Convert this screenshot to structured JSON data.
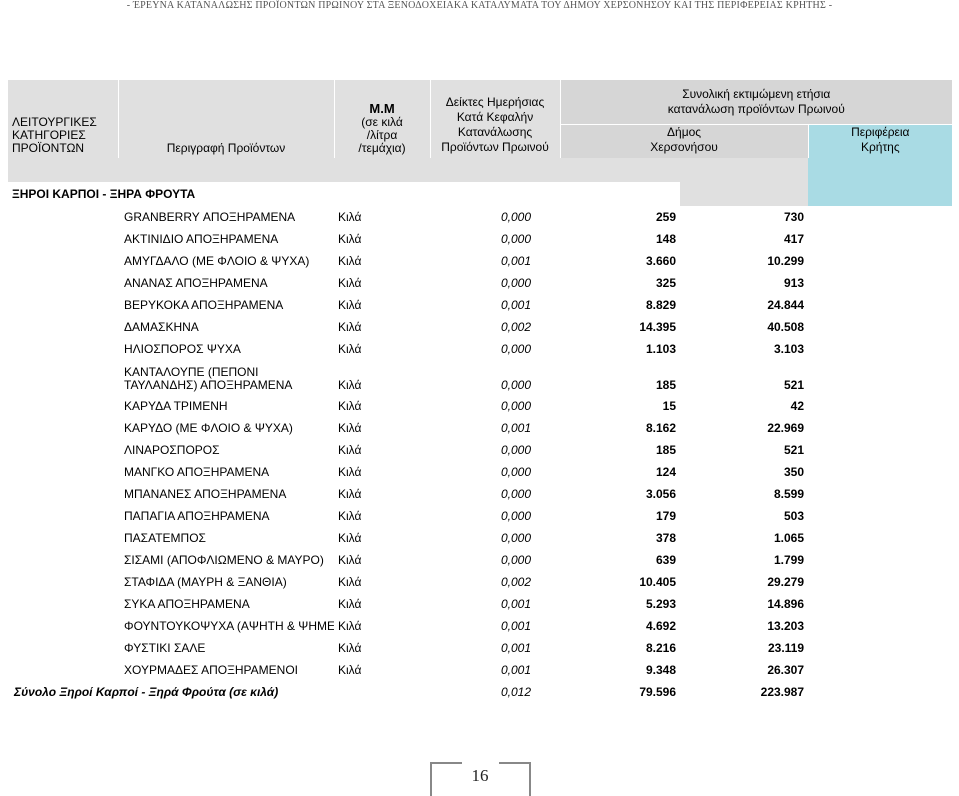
{
  "running_header": "- ΈΡΕΥΝΑ ΚΑΤΑΝΑΛΩΣΗΣ ΠΡΟΪΟΝΤΩΝ ΠΡΩΙΝΟΥ ΣΤΑ ΞΕΝΟΔΟΧΕΙΑΚΑ ΚΑΤΑΛΥΜΑΤΑ ΤΟΥ ΔΗΜΟΥ ΧΕΡΣΟΝΗΣΟΥ ΚΑΙ ΤΗΣ ΠΕΡΙΦΕΡΕΙΑΣ ΚΡΗΤΗΣ -",
  "header": {
    "category": [
      "ΛΕΙΤΟΥΡΓΙΚΕΣ",
      "ΚΑΤΗΓΟΡΙΕΣ",
      "ΠΡΟΪΟΝΤΩΝ"
    ],
    "description": "Περιγραφή Προϊόντων",
    "unit": [
      "Μ.Μ",
      "(σε κιλά",
      "/λίτρα",
      "/τεμάχια)"
    ],
    "index": [
      "Δείκτες Ημερήσιας",
      "Κατά Κεφαλήν",
      "Κατανάλωσης",
      "Προϊόντων Πρωινού"
    ],
    "total": [
      "Συνολική εκτιμώμενη ετήσια",
      "κατανάλωση προϊόντων Πρωινού"
    ],
    "dimos": [
      "Δήμος",
      "Χερσονήσου"
    ],
    "perifereia": [
      "Περιφέρεια",
      "Κρήτης"
    ]
  },
  "section_title": "ΞΗΡΟΙ ΚΑΡΠΟΙ - ΞΗΡΑ ΦΡΟΥΤΑ",
  "rows": [
    {
      "name": "GRANBERRY ΑΠΟΞΗΡΑΜΕΝΑ",
      "unit": "Κιλά",
      "index": "0,000",
      "dimos": "259",
      "perifereia": "730"
    },
    {
      "name": "ΑΚΤΙΝΙΔΙΟ ΑΠΟΞΗΡΑΜΕΝΑ",
      "unit": "Κιλά",
      "index": "0,000",
      "dimos": "148",
      "perifereia": "417"
    },
    {
      "name": "ΑΜΥΓΔΑΛΟ (ΜΕ ΦΛΟΙΟ & ΨΥΧΑ)",
      "unit": "Κιλά",
      "index": "0,001",
      "dimos": "3.660",
      "perifereia": "10.299"
    },
    {
      "name": "ΑΝΑΝΑΣ ΑΠΟΞΗΡΑΜΕΝΑ",
      "unit": "Κιλά",
      "index": "0,000",
      "dimos": "325",
      "perifereia": "913"
    },
    {
      "name": "ΒΕΡΥΚΟΚΑ ΑΠΟΞΗΡΑΜΕΝΑ",
      "unit": "Κιλά",
      "index": "0,001",
      "dimos": "8.829",
      "perifereia": "24.844"
    },
    {
      "name": "ΔΑΜΑΣΚΗΝΑ",
      "unit": "Κιλά",
      "index": "0,002",
      "dimos": "14.395",
      "perifereia": "40.508"
    },
    {
      "name": "ΗΛΙΟΣΠΟΡΟΣ ΨΥΧΑ",
      "unit": "Κιλά",
      "index": "0,000",
      "dimos": "1.103",
      "perifereia": "3.103"
    },
    {
      "name": "ΚΑΝΤΑΛΟΥΠΕ (ΠΕΠΟΝΙ ΤΑΥΛΑΝΔΗΣ) ΑΠΟΞΗΡΑΜΕΝΑ",
      "unit": "Κιλά",
      "index": "0,000",
      "dimos": "185",
      "perifereia": "521"
    },
    {
      "name": "ΚΑΡΥΔΑ ΤΡΙΜΕΝΗ",
      "unit": "Κιλά",
      "index": "0,000",
      "dimos": "15",
      "perifereia": "42"
    },
    {
      "name": "ΚΑΡΥΔΟ (ΜΕ ΦΛΟΙΟ & ΨΥΧΑ)",
      "unit": "Κιλά",
      "index": "0,001",
      "dimos": "8.162",
      "perifereia": "22.969"
    },
    {
      "name": "ΛΙΝΑΡΟΣΠΟΡΟΣ",
      "unit": "Κιλά",
      "index": "0,000",
      "dimos": "185",
      "perifereia": "521"
    },
    {
      "name": "ΜΑΝΓΚΟ ΑΠΟΞΗΡΑΜΕΝΑ",
      "unit": "Κιλά",
      "index": "0,000",
      "dimos": "124",
      "perifereia": "350"
    },
    {
      "name": "ΜΠΑΝΑΝΕΣ ΑΠΟΞΗΡΑΜΕΝΑ",
      "unit": "Κιλά",
      "index": "0,000",
      "dimos": "3.056",
      "perifereia": "8.599"
    },
    {
      "name": "ΠΑΠΑΓΙΑ ΑΠΟΞΗΡΑΜΕΝΑ",
      "unit": "Κιλά",
      "index": "0,000",
      "dimos": "179",
      "perifereia": "503"
    },
    {
      "name": "ΠΑΣΑΤΕΜΠΟΣ",
      "unit": "Κιλά",
      "index": "0,000",
      "dimos": "378",
      "perifereia": "1.065"
    },
    {
      "name": "ΣΙΣΑΜΙ (ΑΠΟΦΛΙΩΜΕΝΟ & ΜΑΥΡΟ)",
      "unit": "Κιλά",
      "index": "0,000",
      "dimos": "639",
      "perifereia": "1.799"
    },
    {
      "name": "ΣΤΑΦΙΔΑ (ΜΑΥΡΗ & ΞΑΝΘΙΑ)",
      "unit": "Κιλά",
      "index": "0,002",
      "dimos": "10.405",
      "perifereia": "29.279"
    },
    {
      "name": "ΣΥΚΑ ΑΠΟΞΗΡΑΜΕΝΑ",
      "unit": "Κιλά",
      "index": "0,001",
      "dimos": "5.293",
      "perifereia": "14.896"
    },
    {
      "name": "ΦΟΥΝΤΟΥΚΟΨΥΧΑ (ΑΨΗΤΗ & ΨΗΜΕΝΑ)",
      "unit": "Κιλά",
      "index": "0,001",
      "dimos": "4.692",
      "perifereia": "13.203"
    },
    {
      "name": "ΦΥΣΤΙΚΙ ΣΑΛΕ",
      "unit": "Κιλά",
      "index": "0,001",
      "dimos": "8.216",
      "perifereia": "23.119"
    },
    {
      "name": "ΧΟΥΡΜΑΔΕΣ ΑΠΟΞΗΡΑΜΕΝΟΙ",
      "unit": "Κιλά",
      "index": "0,001",
      "dimos": "9.348",
      "perifereia": "26.307"
    }
  ],
  "total": {
    "label": "Σύνολο Ξηροί Καρποί - Ξηρά Φρούτα (σε κιλά)",
    "index": "0,012",
    "dimos": "79.596",
    "perifereia": "223.987"
  },
  "page_number": "16",
  "colors": {
    "header_gray": "#e0e0e0",
    "header_blue": "#a9dbe4"
  }
}
